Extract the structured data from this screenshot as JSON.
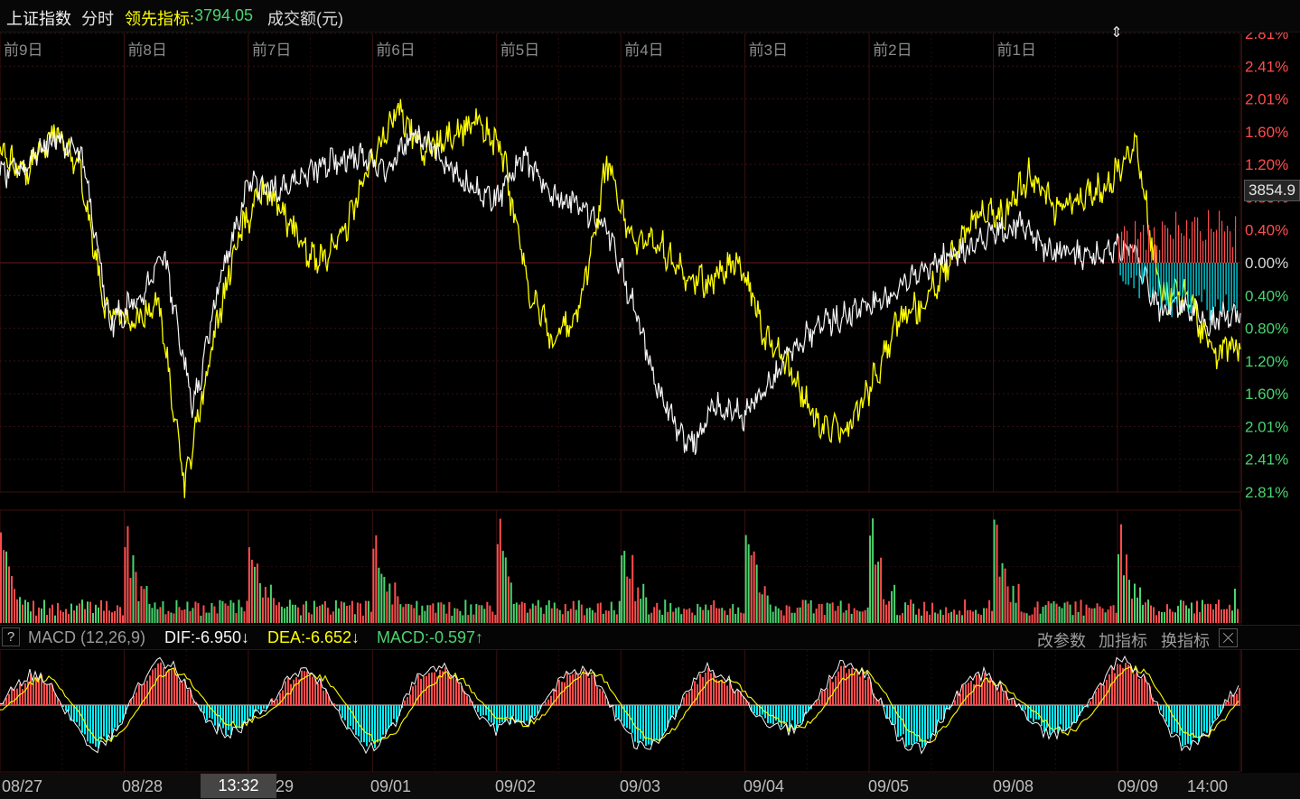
{
  "header": {
    "index_name": "上证指数",
    "period": "分时",
    "lead_label": "领先指标:",
    "lead_value": "3794.05",
    "volume_label": "成交额(元)"
  },
  "price_box": {
    "value": "3854.9"
  },
  "time_box": {
    "value": "13:32"
  },
  "macd_bar": {
    "help": "?",
    "title": "MACD (12,26,9)",
    "dif": "DIF:-6.950↓",
    "dea": "DEA:-6.652↓",
    "macd": "MACD:-0.597↑",
    "change_params": "改参数",
    "add_indicator": "加指标",
    "switch_indicator": "换指标"
  },
  "colors": {
    "background": "#000000",
    "grid": "#3a1111",
    "up": "#ff4d4d",
    "down": "#49d46f",
    "white_line": "#f5f5f5",
    "yellow_line": "#ffff00",
    "macd_negative": "#00f0ff"
  },
  "chart_data": {
    "type": "line",
    "day_labels": [
      "前9日",
      "前8日",
      "前7日",
      "前6日",
      "前5日",
      "前4日",
      "前3日",
      "前2日",
      "前1日"
    ],
    "x_labels": [
      "08/27",
      "08/28",
      "13:32",
      "29",
      "09/01",
      "09/02",
      "09/03",
      "09/04",
      "09/05",
      "09/08",
      "09/09",
      "14:00"
    ],
    "y_ticks": [
      "2.81%",
      "2.41%",
      "2.01%",
      "1.60%",
      "1.20%",
      "0.80%",
      "0.40%",
      "0.00%",
      "0.40%",
      "0.80%",
      "1.20%",
      "1.60%",
      "2.01%",
      "2.41%",
      "2.81%"
    ],
    "series": [
      {
        "values": [
          1.06,
          1.22,
          1.52,
          1.25,
          -0.76,
          -0.42,
          0.03,
          -1.81,
          -0.18,
          0.95,
          0.89,
          1.03,
          1.24,
          1.28,
          1.12,
          1.6,
          1.31,
          0.94,
          0.76,
          1.29,
          0.78,
          0.73,
          0.43,
          -0.55,
          -1.65,
          -2.28,
          -1.75,
          -1.86,
          -1.43,
          -0.98,
          -0.73,
          -0.6,
          -0.46,
          -0.21,
          0.03,
          0.14,
          0.37,
          0.48,
          0.17,
          0.13,
          0.09,
          0.23,
          -0.53,
          -0.55,
          -0.72,
          -0.6
        ]
      },
      {
        "values": [
          1.32,
          1.1,
          1.62,
          1.15,
          -0.54,
          -0.78,
          -0.44,
          -2.78,
          -1.06,
          0.32,
          0.92,
          0.45,
          0.0,
          0.33,
          1.18,
          1.88,
          1.4,
          1.55,
          1.72,
          1.4,
          -0.3,
          -0.95,
          -0.55,
          1.23,
          0.23,
          0.25,
          -0.21,
          -0.22,
          0.04,
          -0.91,
          -1.32,
          -1.98,
          -2.05,
          -1.52,
          -0.7,
          -0.5,
          0.05,
          0.62,
          0.58,
          1.08,
          0.65,
          0.81,
          0.95,
          1.5,
          -0.4,
          -0.44,
          -1.14,
          -0.97
        ]
      }
    ]
  }
}
